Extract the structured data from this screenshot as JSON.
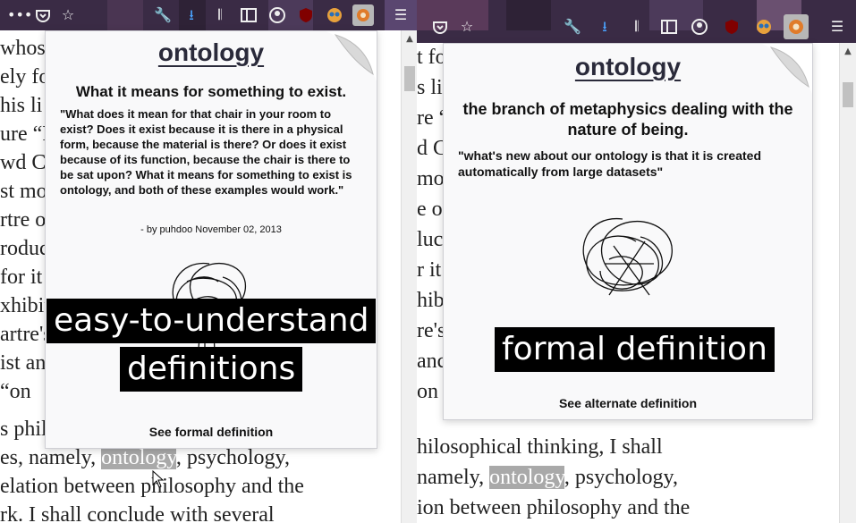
{
  "left": {
    "article_lines": [
      {
        "text": "whose"
      },
      {
        "text": "ely fo"
      },
      {
        "text": "his li"
      },
      {
        "text": "ure “F"
      },
      {
        "text": "wd C"
      },
      {
        "text": "st mo"
      },
      {
        "text": "rtre o"
      },
      {
        "text": "roduc"
      },
      {
        "text": " for it"
      },
      {
        "text": "xhibit"
      },
      {
        "text": "artre's"
      },
      {
        "text": "ist anc"
      },
      {
        "text": " “on"
      },
      {
        "text": "s phil"
      }
    ],
    "line_es_pre": "es, namely, ",
    "line_es_hl": "ontology",
    "line_es_post": ", psychology,",
    "line_rel": "elation between philosophy and the",
    "line_rk": "rk. I shall conclude with several",
    "popup": {
      "word": "ontology",
      "meaning": "What it means for something to exist.",
      "example": "\"What does it mean for that chair in your room to exist? Does it exist because it is there in a physical form, because the material is there? Or does it exist because of its function, because the chair is there to be sat upon? What it means for something to exist is ontology, and both of these examples would work.\"",
      "author": "- by puhdoo November 02, 2013",
      "switch_label": "See formal definition"
    },
    "caption_line1": "easy-to-understand",
    "caption_line2": "definitions"
  },
  "right": {
    "article_lines": [
      {
        "text": "t fo"
      },
      {
        "text": "s li"
      },
      {
        "text": "re “F"
      },
      {
        "text": "d C"
      },
      {
        "text": " mo"
      },
      {
        "text": "e o"
      },
      {
        "text": "luc"
      },
      {
        "text": "r it"
      },
      {
        "text": "hibi"
      },
      {
        "text": "re's"
      },
      {
        "text": "anc"
      },
      {
        "text": "on"
      }
    ],
    "line_phil": "hilosophical thinking, I shall",
    "line_nam_pre": "namely, ",
    "line_nam_hl": "ontology",
    "line_nam_post": ", psychology,",
    "line_ion": "ion between philosophy and the",
    "popup": {
      "word": "ontology",
      "meaning": "the branch of metaphysics dealing with the nature of being.",
      "example": "\"what's new about our ontology is that it is created automatically from large datasets\"",
      "switch_label": "See alternate definition"
    },
    "caption": "formal definition"
  },
  "colors": {
    "toolbar_bg": "#3a2b45",
    "highlight": "#a9a9a9",
    "caption_bg": "#000000"
  }
}
